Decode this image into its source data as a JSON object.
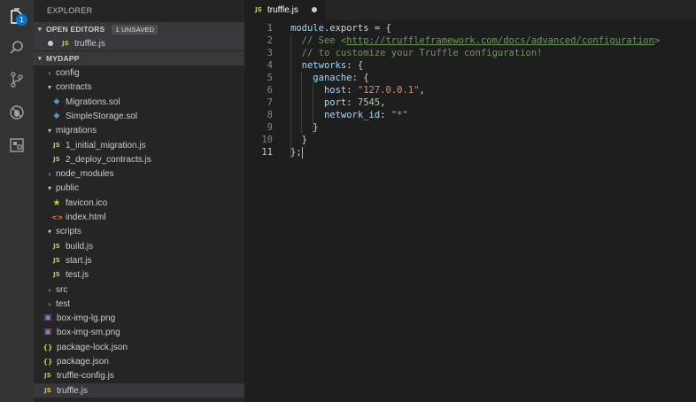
{
  "activity": {
    "badge": "1",
    "icons": [
      "files-icon",
      "search-icon",
      "source-control-icon",
      "debug-icon",
      "extensions-icon"
    ]
  },
  "sidebar": {
    "title": "EXPLORER",
    "open_editors": {
      "header": "OPEN EDITORS",
      "badge": "1 UNSAVED",
      "files": [
        {
          "type": "JS",
          "name": "truffle.js"
        }
      ]
    },
    "project": {
      "header": "MYDAPP",
      "tree": [
        {
          "kind": "folder",
          "name": "config",
          "open": false
        },
        {
          "kind": "folder",
          "name": "contracts",
          "open": true
        },
        {
          "kind": "file",
          "type": "sol",
          "name": "Migrations.sol"
        },
        {
          "kind": "file",
          "type": "sol",
          "name": "SimpleStorage.sol"
        },
        {
          "kind": "folder",
          "name": "migrations",
          "open": true
        },
        {
          "kind": "file",
          "type": "JS",
          "name": "1_initial_migration.js"
        },
        {
          "kind": "file",
          "type": "JS",
          "name": "2_deploy_contracts.js"
        },
        {
          "kind": "folder",
          "name": "node_modules",
          "open": false
        },
        {
          "kind": "folder",
          "name": "public",
          "open": true
        },
        {
          "kind": "file",
          "type": "star",
          "name": "favicon.ico"
        },
        {
          "kind": "file",
          "type": "html",
          "name": "index.html"
        },
        {
          "kind": "folder",
          "name": "scripts",
          "open": true
        },
        {
          "kind": "file",
          "type": "JS",
          "name": "build.js"
        },
        {
          "kind": "file",
          "type": "JS",
          "name": "start.js"
        },
        {
          "kind": "file",
          "type": "JS",
          "name": "test.js"
        },
        {
          "kind": "folder",
          "name": "src",
          "open": false
        },
        {
          "kind": "folder",
          "name": "test",
          "open": false
        },
        {
          "kind": "file",
          "type": "img",
          "name": "box-img-lg.png"
        },
        {
          "kind": "file",
          "type": "img",
          "name": "box-img-sm.png"
        },
        {
          "kind": "file",
          "type": "json",
          "name": "package-lock.json"
        },
        {
          "kind": "file",
          "type": "json",
          "name": "package.json"
        },
        {
          "kind": "file",
          "type": "JS",
          "name": "truffle-config.js"
        },
        {
          "kind": "file",
          "type": "JS",
          "name": "truffle.js",
          "selected": true
        }
      ]
    }
  },
  "editor": {
    "tab": {
      "type": "JS",
      "name": "truffle.js"
    },
    "lines": [
      {
        "n": "1",
        "tokens": [
          [
            "var",
            "module"
          ],
          [
            "kw",
            ".exports = {"
          ]
        ]
      },
      {
        "n": "2",
        "tokens": [
          [
            "kw",
            "  "
          ],
          [
            "com",
            "// See <"
          ],
          [
            "link",
            "http://truffleframework.com/docs/advanced/configuration"
          ],
          [
            "com",
            ">"
          ]
        ]
      },
      {
        "n": "3",
        "tokens": [
          [
            "kw",
            "  "
          ],
          [
            "com",
            "// to customize your Truffle configuration!"
          ]
        ]
      },
      {
        "n": "4",
        "tokens": [
          [
            "kw",
            "  "
          ],
          [
            "var",
            "networks"
          ],
          [
            "kw",
            ": {"
          ]
        ]
      },
      {
        "n": "5",
        "tokens": [
          [
            "kw",
            "    "
          ],
          [
            "var",
            "ganache"
          ],
          [
            "kw",
            ": {"
          ]
        ]
      },
      {
        "n": "6",
        "tokens": [
          [
            "kw",
            "      "
          ],
          [
            "var",
            "host"
          ],
          [
            "kw",
            ": "
          ],
          [
            "str",
            "\"127.0.0.1\""
          ],
          [
            "kw",
            ","
          ]
        ]
      },
      {
        "n": "7",
        "tokens": [
          [
            "kw",
            "      "
          ],
          [
            "var",
            "port"
          ],
          [
            "kw",
            ": "
          ],
          [
            "num",
            "7545"
          ],
          [
            "kw",
            ","
          ]
        ]
      },
      {
        "n": "8",
        "tokens": [
          [
            "kw",
            "      "
          ],
          [
            "var",
            "network_id"
          ],
          [
            "kw",
            ": "
          ],
          [
            "str",
            "\"*\""
          ]
        ]
      },
      {
        "n": "9",
        "tokens": [
          [
            "kw",
            "    }"
          ]
        ]
      },
      {
        "n": "10",
        "tokens": [
          [
            "kw",
            "  }"
          ]
        ]
      },
      {
        "n": "11",
        "tokens": [
          [
            "kw",
            "};"
          ]
        ],
        "current": true
      }
    ]
  }
}
